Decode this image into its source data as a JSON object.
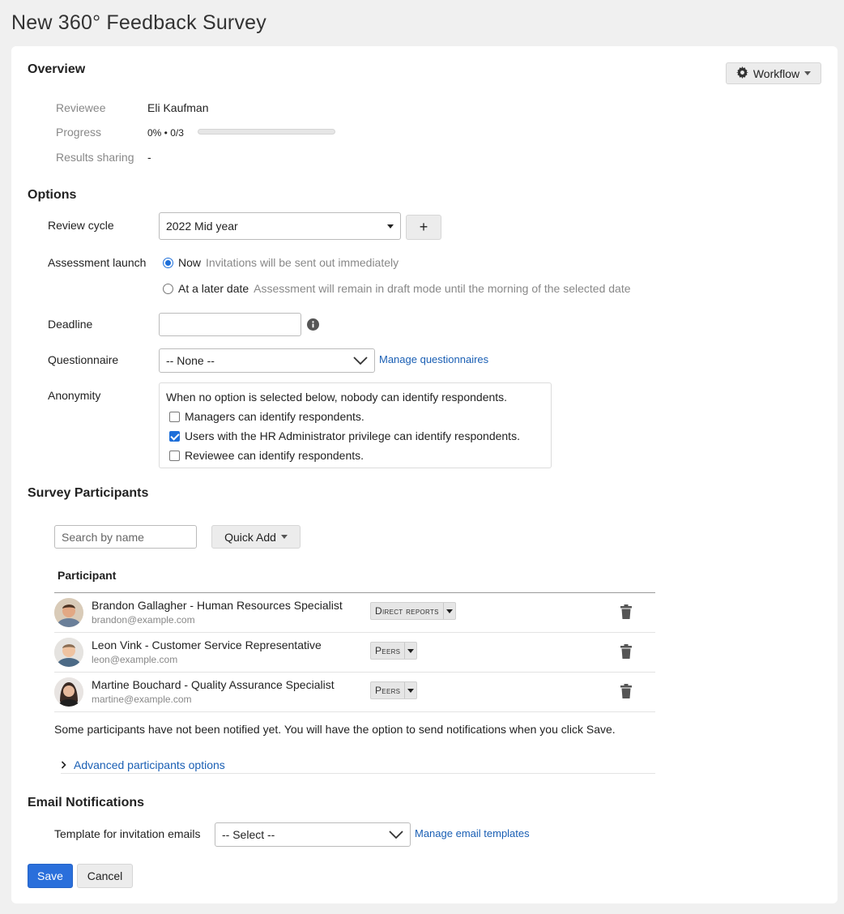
{
  "page": {
    "title": "New 360° Feedback Survey"
  },
  "overview": {
    "heading": "Overview",
    "workflow_label": "Workflow",
    "fields": {
      "reviewee_label": "Reviewee",
      "reviewee_value": "Eli Kaufman",
      "progress_label": "Progress",
      "progress_text": "0% • 0/3",
      "progress_fraction": 0,
      "results_label": "Results sharing",
      "results_value": "-"
    }
  },
  "options": {
    "heading": "Options",
    "review_cycle": {
      "label": "Review cycle",
      "value": "2022 Mid year",
      "add_label": "+"
    },
    "assessment_launch": {
      "label": "Assessment launch",
      "options": [
        {
          "label": "Now",
          "hint": "Invitations will be sent out immediately",
          "selected": true
        },
        {
          "label": "At a later date",
          "hint": "Assessment will remain in draft mode until the morning of the selected date",
          "selected": false
        }
      ]
    },
    "deadline": {
      "label": "Deadline",
      "value": ""
    },
    "questionnaire": {
      "label": "Questionnaire",
      "value": "-- None --",
      "manage_link": "Manage questionnaires"
    },
    "anonymity": {
      "label": "Anonymity",
      "intro": "When no option is selected below, nobody can identify respondents.",
      "options": [
        {
          "label": "Managers can identify respondents.",
          "checked": false
        },
        {
          "label": "Users with the HR Administrator privilege can identify respondents.",
          "checked": true
        },
        {
          "label": "Reviewee can identify respondents.",
          "checked": false
        }
      ]
    }
  },
  "participants": {
    "heading": "Survey Participants",
    "search_placeholder": "Search by name",
    "quick_add_label": "Quick Add",
    "column_header": "Participant",
    "rows": [
      {
        "name": "Brandon Gallagher - Human Resources Specialist",
        "email": "brandon@example.com",
        "relation": "Direct reports"
      },
      {
        "name": "Leon Vink - Customer Service Representative",
        "email": "leon@example.com",
        "relation": "Peers"
      },
      {
        "name": "Martine Bouchard - Quality Assurance Specialist",
        "email": "martine@example.com",
        "relation": "Peers"
      }
    ],
    "notice": "Some participants have not been notified yet. You will have the option to send notifications when you click Save.",
    "advanced_label": "Advanced participants options"
  },
  "email": {
    "heading": "Email Notifications",
    "template_label": "Template for invitation emails",
    "template_value": "-- Select --",
    "manage_link": "Manage email templates"
  },
  "actions": {
    "save_label": "Save",
    "cancel_label": "Cancel"
  },
  "colors": {
    "primary": "#2a6fdb",
    "link": "#1a5fb4",
    "background": "#f0f0f0",
    "card": "#ffffff"
  },
  "icons": {
    "workflow": "gear-icon",
    "deadline_info": "info-icon",
    "delete": "trash-icon",
    "expand": "chevron-right-icon",
    "dropdown": "chevron-down-icon"
  }
}
